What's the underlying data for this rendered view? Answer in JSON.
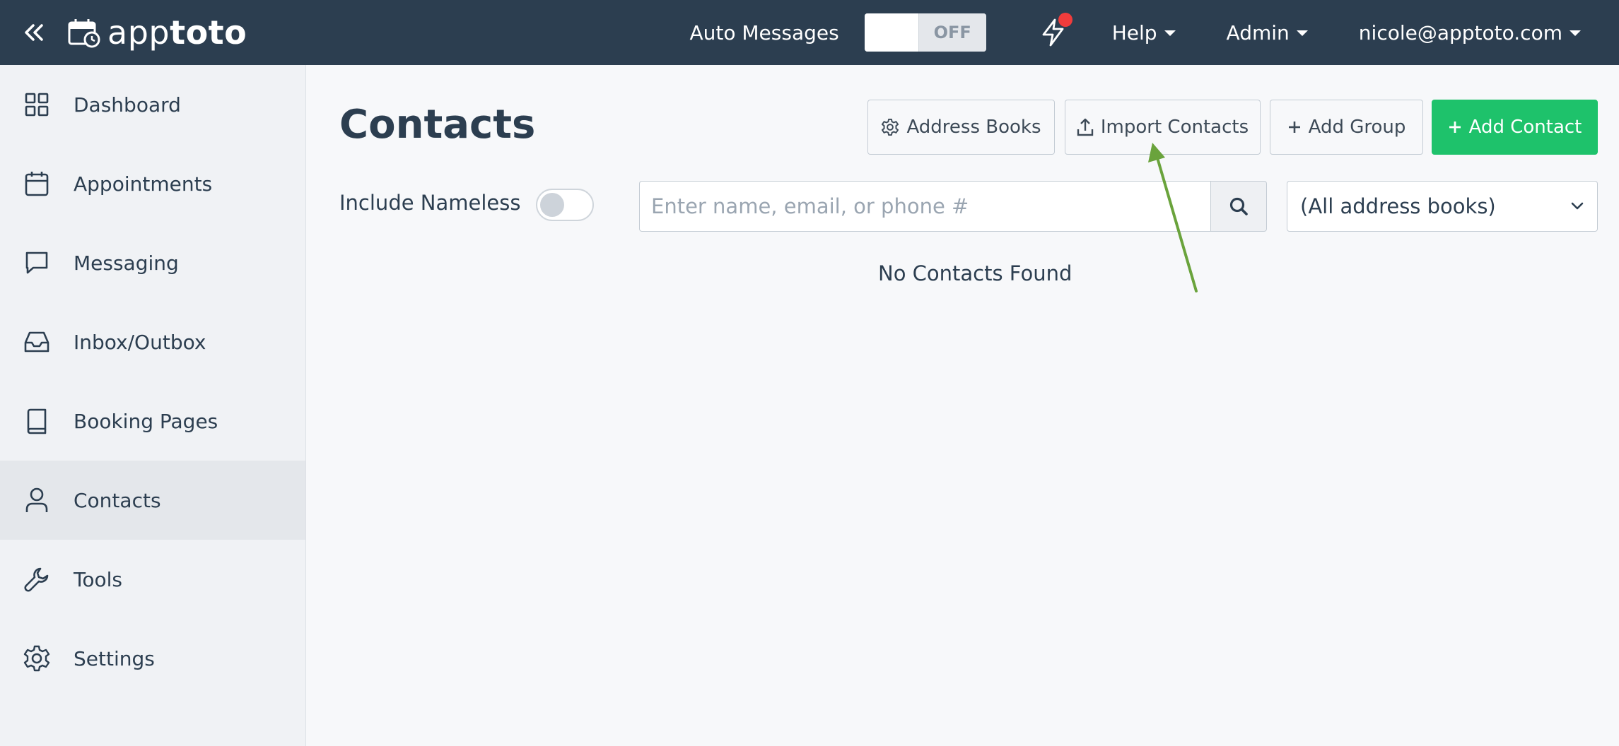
{
  "topbar": {
    "brand_prefix": "app",
    "brand_suffix": "toto",
    "auto_messages_label": "Auto Messages",
    "auto_messages_state": "OFF",
    "help_label": "Help",
    "admin_label": "Admin",
    "user_email": "nicole@apptoto.com"
  },
  "sidebar": {
    "items": [
      {
        "label": "Dashboard",
        "icon": "grid-icon"
      },
      {
        "label": "Appointments",
        "icon": "calendar-icon"
      },
      {
        "label": "Messaging",
        "icon": "chat-icon"
      },
      {
        "label": "Inbox/Outbox",
        "icon": "inbox-icon"
      },
      {
        "label": "Booking Pages",
        "icon": "book-icon"
      },
      {
        "label": "Contacts",
        "icon": "person-icon",
        "active": true
      },
      {
        "label": "Tools",
        "icon": "wrench-icon"
      },
      {
        "label": "Settings",
        "icon": "gear-icon"
      }
    ]
  },
  "main": {
    "title": "Contacts",
    "address_books_label": "Address Books",
    "import_label": "Import Contacts",
    "add_group_label": "Add Group",
    "add_contact_label": "Add Contact",
    "include_nameless_label": "Include Nameless",
    "search_placeholder": "Enter name, email, or phone #",
    "address_book_selected": "(All address books)",
    "empty_message": "No Contacts Found"
  },
  "colors": {
    "topbar": "#2c3e50",
    "accent_green": "#1ec26b",
    "annotation_arrow": "#6aa33c",
    "notification_dot": "#f03c3c"
  }
}
